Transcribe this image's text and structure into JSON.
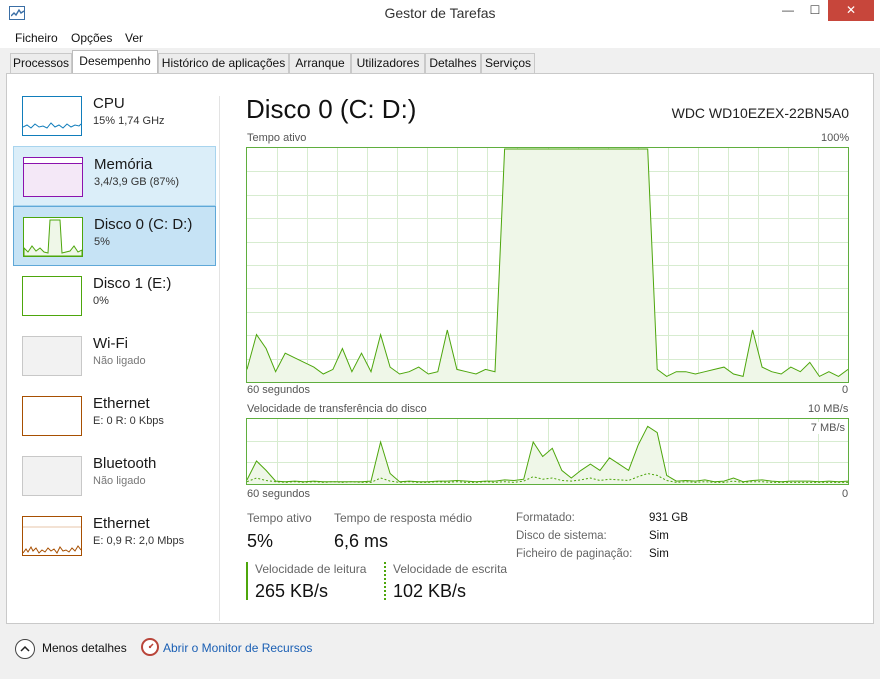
{
  "window": {
    "title": "Gestor de Tarefas",
    "min_glyph": "—",
    "max_glyph": "☐",
    "close_glyph": "✕"
  },
  "menu": [
    "Ficheiro",
    "Opções",
    "Ver"
  ],
  "tabs": [
    {
      "label": "Processos",
      "active": false
    },
    {
      "label": "Desempenho",
      "active": true
    },
    {
      "label": "Histórico de aplicações",
      "active": false
    },
    {
      "label": "Arranque",
      "active": false
    },
    {
      "label": "Utilizadores",
      "active": false
    },
    {
      "label": "Detalhes",
      "active": false
    },
    {
      "label": "Serviços",
      "active": false
    }
  ],
  "sidebar": [
    {
      "title": "CPU",
      "sub": "15% 1,74 GHz",
      "color": "#117dbb"
    },
    {
      "title": "Memória",
      "sub": "3,4/3,9 GB (87%)",
      "color": "#8b12ae"
    },
    {
      "title": "Disco 0 (C: D:)",
      "sub": "5%",
      "color": "#4da60c"
    },
    {
      "title": "Disco 1 (E:)",
      "sub": "0%",
      "color": "#4da60c"
    },
    {
      "title": "Wi-Fi",
      "sub": "Não ligado",
      "color": "#bbbbbb"
    },
    {
      "title": "Ethernet",
      "sub": "E: 0 R: 0 Kbps",
      "color": "#a74f01"
    },
    {
      "title": "Bluetooth",
      "sub": "Não ligado",
      "color": "#bbbbbb"
    },
    {
      "title": "Ethernet",
      "sub": "E: 0,9 R: 2,0 Mbps",
      "color": "#a74f01"
    }
  ],
  "detail": {
    "title": "Disco 0 (C: D:)",
    "model": "WDC WD10EZEX-22BN5A0",
    "active_time": {
      "label": "Tempo ativo",
      "max_label": "100%",
      "time_label": "60 segundos",
      "min_label": "0",
      "values": [
        5,
        20,
        14,
        4,
        12,
        10,
        8,
        6,
        3,
        5,
        14,
        4,
        12,
        4,
        20,
        6,
        3,
        4,
        6,
        3,
        4,
        22,
        5,
        4,
        3,
        5,
        4,
        100,
        100,
        100,
        100,
        100,
        100,
        100,
        100,
        100,
        100,
        100,
        100,
        100,
        100,
        100,
        100,
        5,
        2,
        4,
        4,
        3,
        4,
        5,
        6,
        3,
        2,
        22,
        6,
        4,
        3,
        6,
        4,
        8,
        2,
        4,
        2,
        5
      ]
    },
    "transfer": {
      "label": "Velocidade de transferência do disco",
      "max_label": "10 MB/s",
      "scale_label": "7 MB/s",
      "time_label": "60 segundos",
      "min_label": "0",
      "unit": "MB/s",
      "read_values": [
        0.5,
        3.5,
        2,
        0.3,
        0.2,
        0.3,
        0.2,
        0.3,
        0.2,
        0.2,
        0.2,
        0.2,
        0.2,
        0.3,
        6.5,
        1.5,
        0.2,
        0.3,
        0.2,
        0.2,
        0.3,
        0.3,
        0.4,
        0.3,
        0.2,
        0.3,
        0.3,
        0.5,
        0.4,
        0.6,
        6.5,
        4.2,
        5.5,
        2,
        0.8,
        2,
        3,
        2,
        4,
        3,
        2,
        6,
        9,
        8,
        1.2,
        0.3,
        0.4,
        0.3,
        0.5,
        0.2,
        0.3,
        0.8,
        0.2,
        0.4,
        0.5,
        0.3,
        0.2,
        0.3,
        0.3,
        0.3,
        0.2,
        0.3,
        0.2,
        0.3
      ],
      "write_values": [
        0.2,
        0.8,
        0.4,
        0.2,
        0.1,
        0.2,
        0.1,
        0.2,
        0.1,
        0.2,
        0.1,
        0.2,
        0.1,
        0.1,
        0.8,
        0.3,
        0.1,
        0.2,
        0.1,
        0.1,
        0.2,
        0.1,
        0.2,
        0.1,
        0.1,
        0.2,
        0.1,
        0.2,
        0.1,
        0.3,
        1,
        0.6,
        0.8,
        0.4,
        0.3,
        0.5,
        0.8,
        0.4,
        0.6,
        0.5,
        0.4,
        1,
        1.5,
        1.2,
        0.4,
        0.1,
        0.2,
        0.1,
        0.2,
        0.1,
        0.1,
        0.3,
        0.1,
        0.2,
        0.2,
        0.1,
        0.1,
        0.1,
        0.1,
        0.1,
        0.1,
        0.1,
        0.1,
        0.1
      ]
    },
    "stats": {
      "active_label": "Tempo ativo",
      "active_value": "5%",
      "resp_label": "Tempo de resposta médio",
      "resp_value": "6,6 ms",
      "read_label": "Velocidade de leitura",
      "read_value": "265 KB/s",
      "write_label": "Velocidade de escrita",
      "write_value": "102 KB/s"
    },
    "properties": [
      {
        "label": "Formatado:",
        "value": "931 GB"
      },
      {
        "label": "Disco de sistema:",
        "value": "Sim"
      },
      {
        "label": "Ficheiro de paginação:",
        "value": "Sim"
      }
    ]
  },
  "footer": {
    "less_label": "Menos detalhes",
    "monitor_label": "Abrir o Monitor de Recursos"
  },
  "colors": {
    "disk": "#4da60c",
    "disk_fill": "#eff7e8",
    "grid": "#d7ecd0"
  }
}
